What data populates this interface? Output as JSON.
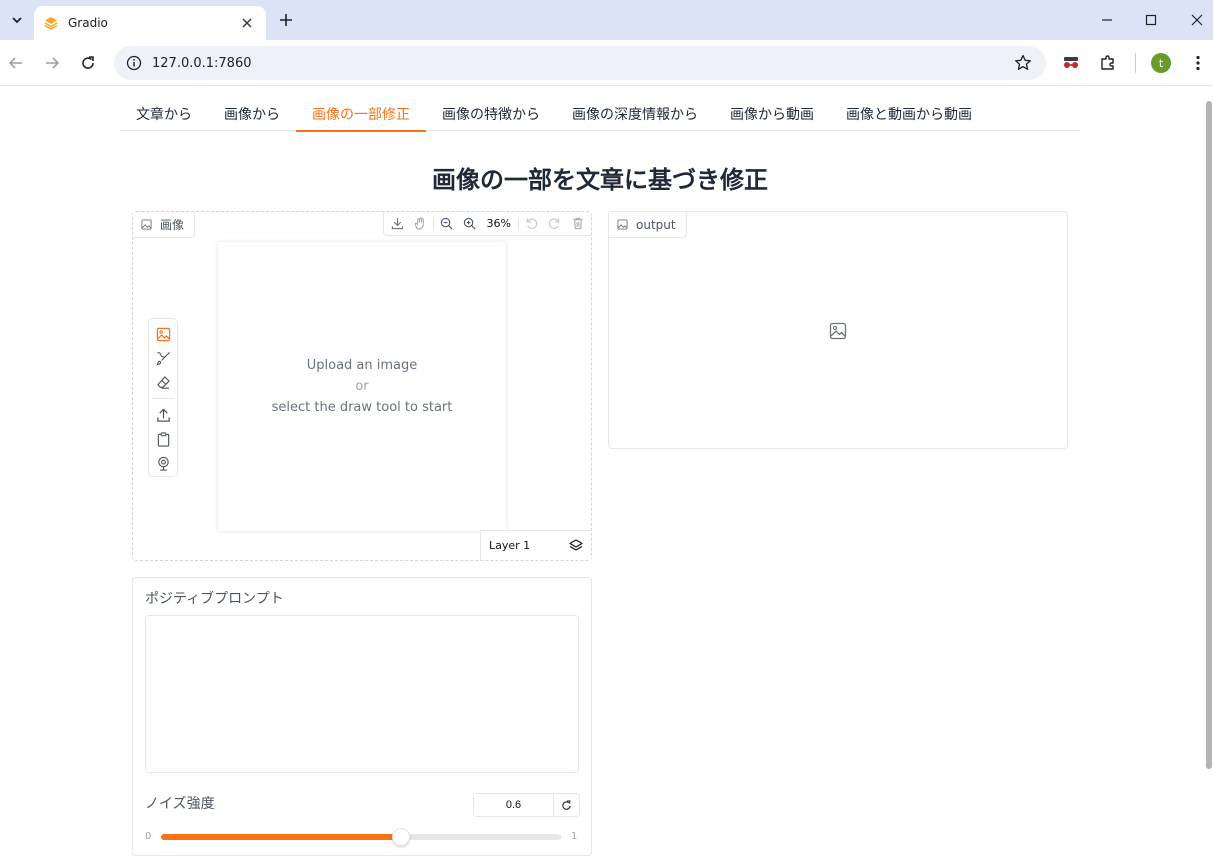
{
  "browser": {
    "tab_title": "Gradio",
    "url": "127.0.0.1:7860",
    "avatar_letter": "t",
    "favicon_color": "#f5a623"
  },
  "tabs": [
    "文章から",
    "画像から",
    "画像の一部修正",
    "画像の特徴から",
    "画像の深度情報から",
    "画像から動画",
    "画像と動画から動画"
  ],
  "selected_tab_index": 2,
  "page": {
    "title": "画像の一部を文章に基づき修正"
  },
  "editor": {
    "label": "画像",
    "zoom": "36%",
    "canvas_line1": "Upload an image",
    "canvas_line2": "or",
    "canvas_line3": "select the draw tool to start",
    "layer": "Layer 1"
  },
  "output": {
    "label": "output"
  },
  "prompt": {
    "label": "ポジティブプロンプト",
    "value": ""
  },
  "slider": {
    "label": "ノイズ強度",
    "value": "0.6",
    "min": "0",
    "max": "1",
    "fraction": 0.6
  },
  "colors": {
    "accent": "#f97316",
    "tab_strip": "#dbe4f7"
  }
}
